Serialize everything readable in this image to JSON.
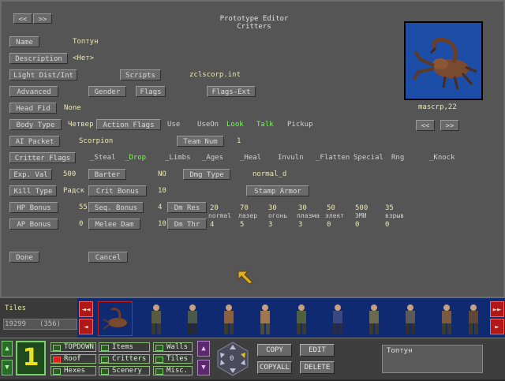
{
  "header": {
    "nav_prev": "<<",
    "nav_next": ">>",
    "title": "Prototype Editor",
    "subtitle": "Critters"
  },
  "fields": {
    "name_label": "Name",
    "name_value": "Топтун",
    "description_label": "Description",
    "description_value": "<Нет>",
    "light_label": "Light Dist/Int",
    "scripts_label": "Scripts",
    "scripts_value": "zclscorp.int",
    "advanced_label": "Advanced",
    "gender_label": "Gender",
    "flags_label": "Flags",
    "flags_ext_label": "Flags-Ext",
    "head_fid_label": "Head Fid",
    "head_fid_value": "None",
    "body_type_label": "Body Type",
    "body_type_value": "Четвер",
    "action_flags_label": "Action Flags",
    "action_flags": [
      "Use",
      "UseOn",
      "Look",
      "Talk",
      "Pickup"
    ],
    "ai_packet_label": "AI Packet",
    "ai_packet_value": "Scorpion",
    "team_num_label": "Team Num",
    "team_num_value": "1",
    "critter_flags_label": "Critter Flags",
    "critter_flags": [
      "_Steal",
      "_Drop",
      "_Limbs",
      "_Ages",
      "_Heal",
      "Invuln",
      "_Flatten",
      "Special",
      "Rng",
      "_Knock"
    ],
    "exp_val_label": "Exp. Val",
    "exp_val_value": "500",
    "barter_label": "Barter",
    "barter_value": "NO",
    "dmg_type_label": "Dmg Type",
    "dmg_type_value": "normal_d",
    "kill_type_label": "Kill Type",
    "kill_type_value": "Радск",
    "crit_bonus_label": "Crit Bonus",
    "crit_bonus_value": "10",
    "stamp_armor_label": "Stamp Armor",
    "hp_bonus_label": "HP Bonus",
    "hp_bonus_value": "55",
    "seq_bonus_label": "Seq. Bonus",
    "seq_bonus_value": "4",
    "dm_res_label": "Dm Res",
    "ap_bonus_label": "AP Bonus",
    "ap_bonus_value": "0",
    "melee_dam_label": "Melee Dam",
    "melee_dam_value": "10",
    "dm_thr_label": "Dm Thr",
    "dm_res_values": [
      "20",
      "70",
      "30",
      "30",
      "50",
      "500",
      "35"
    ],
    "dmg_types": [
      "normal",
      "лазер",
      "огонь",
      "плазма",
      "элект",
      "ЭМИ",
      "взрыв"
    ],
    "dm_thr_values": [
      "4",
      "5",
      "3",
      "3",
      "0",
      "0",
      "0"
    ]
  },
  "image": {
    "caption": "mascrp,22",
    "prev": "<<",
    "next": ">>"
  },
  "actions": {
    "done": "Done",
    "cancel": "Cancel"
  },
  "strip": {
    "category": "Tiles",
    "count": "19299",
    "index": "(356)",
    "left1": "◄◄",
    "left2": "◄",
    "right1": "►►",
    "right2": "►"
  },
  "toolbar": {
    "level": "1",
    "topdown": "TOPDOWN",
    "roof": "Roof",
    "hexes": "Hexes",
    "items": "Items",
    "critters": "Critters",
    "scenery": "Scenery",
    "walls": "Walls",
    "tiles": "Tiles",
    "misc": "Misc.",
    "rotation": "0",
    "copy": "COPY",
    "edit": "EDIT",
    "copyall": "COPYALL",
    "delete": "DELETE",
    "selected_name": "Топтун"
  },
  "colors": {
    "panel": "#555555",
    "strip": "#0f2a70",
    "accent_green": "#6cff4c",
    "accent_red": "#b01818",
    "level_yellow": "#e8e020"
  }
}
